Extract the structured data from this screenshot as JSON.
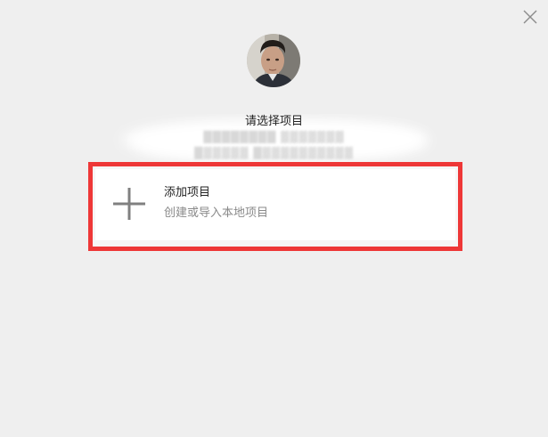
{
  "icons": {
    "close": "close-icon",
    "plus": "plus-icon",
    "avatar": "user-avatar"
  },
  "header": {
    "title": "请选择项目"
  },
  "blurred_lines": [
    "████████ ▓▓▓▓▓▓▓",
    "█▓▓▓▓▓ █▓▓▓▓▓▓▓▓▓▓"
  ],
  "add_project": {
    "label": "添加项目",
    "description": "创建或导入本地项目"
  },
  "colors": {
    "background": "#efefef",
    "highlight_border": "#ee3737",
    "card_background": "#ffffff",
    "title_text": "#222222",
    "subtitle_text": "#8a8a8a",
    "icon": "#808080"
  }
}
